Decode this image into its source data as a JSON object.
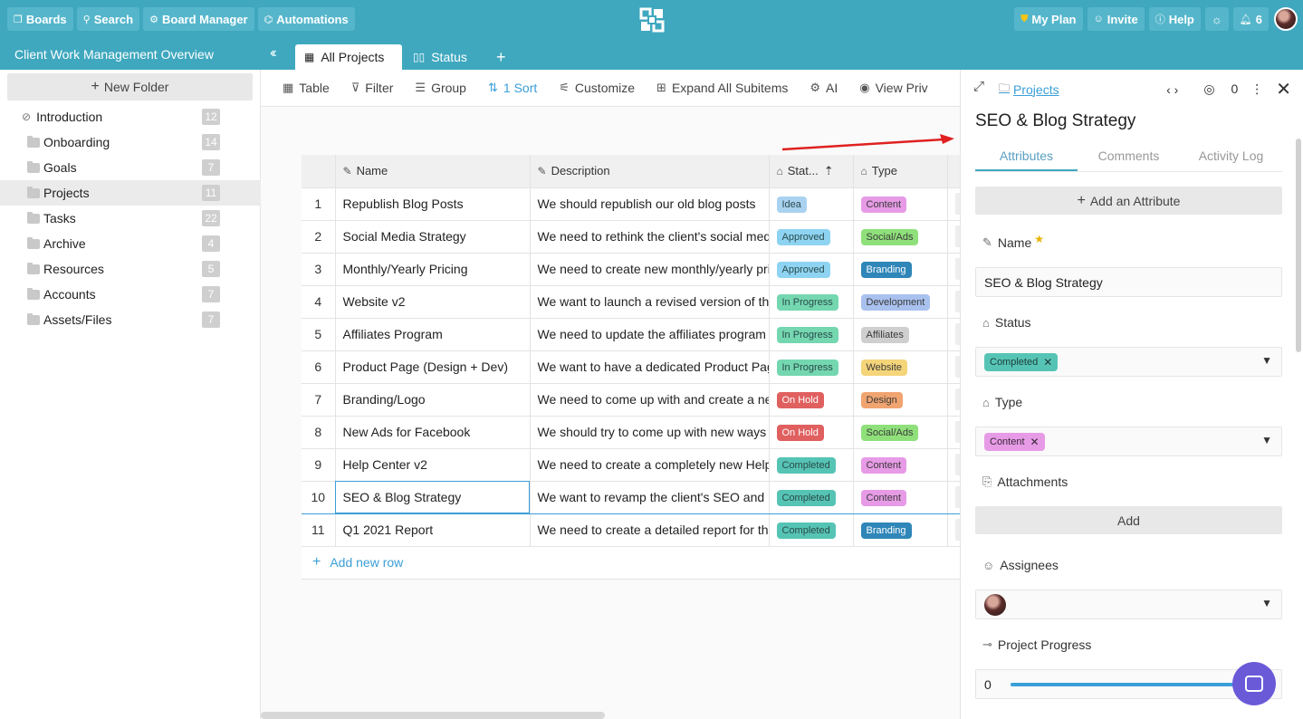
{
  "topbar": {
    "boards": "Boards",
    "search": "Search",
    "board_manager": "Board Manager",
    "automations": "Automations",
    "my_plan": "My Plan",
    "invite": "Invite",
    "help": "Help",
    "notifications": "6"
  },
  "board": {
    "title": "Client Work Management Overview",
    "tabs": [
      {
        "label": "All Projects"
      },
      {
        "label": "Status"
      }
    ]
  },
  "sidebar": {
    "new_folder": "New Folder",
    "folders": [
      {
        "label": "Introduction",
        "count": "12"
      },
      {
        "label": "Onboarding",
        "count": "14"
      },
      {
        "label": "Goals",
        "count": "7"
      },
      {
        "label": "Projects",
        "count": "11"
      },
      {
        "label": "Tasks",
        "count": "22"
      },
      {
        "label": "Archive",
        "count": "4"
      },
      {
        "label": "Resources",
        "count": "5"
      },
      {
        "label": "Accounts",
        "count": "7"
      },
      {
        "label": "Assets/Files",
        "count": "7"
      }
    ]
  },
  "toolbar": {
    "table": "Table",
    "filter": "Filter",
    "group": "Group",
    "sort": "1 Sort",
    "customize": "Customize",
    "expand": "Expand All Subitems",
    "ai": "AI",
    "view": "View Priv"
  },
  "grid": {
    "headers": {
      "name": "Name",
      "description": "Description",
      "status": "Stat...",
      "type": "Type"
    },
    "rows": [
      {
        "n": "1",
        "name": "Republish Blog Posts",
        "desc": "We should republish our old blog posts",
        "status": "Idea",
        "type": "Content"
      },
      {
        "n": "2",
        "name": "Social Media Strategy",
        "desc": "We need to rethink the client's social media",
        "status": "Approved",
        "type": "Social/Ads"
      },
      {
        "n": "3",
        "name": "Monthly/Yearly Pricing",
        "desc": "We need to create new monthly/yearly pricing",
        "status": "Approved",
        "type": "Branding"
      },
      {
        "n": "4",
        "name": "Website v2",
        "desc": "We want to launch a revised version of the",
        "status": "In Progress",
        "type": "Development"
      },
      {
        "n": "5",
        "name": "Affiliates Program",
        "desc": "We need to update the affiliates program",
        "status": "In Progress",
        "type": "Affiliates"
      },
      {
        "n": "6",
        "name": "Product Page (Design + Dev)",
        "desc": "We want to have a dedicated Product Page",
        "status": "In Progress",
        "type": "Website"
      },
      {
        "n": "7",
        "name": "Branding/Logo",
        "desc": "We need to come up with and create a new",
        "status": "On Hold",
        "type": "Design"
      },
      {
        "n": "8",
        "name": "New Ads for Facebook",
        "desc": "We should try to come up with new ways",
        "status": "On Hold",
        "type": "Social/Ads"
      },
      {
        "n": "9",
        "name": "Help Center v2",
        "desc": "We need to create a completely new Help",
        "status": "Completed",
        "type": "Content"
      },
      {
        "n": "10",
        "name": "SEO & Blog Strategy",
        "desc": "We want to revamp the client's SEO and",
        "status": "Completed",
        "type": "Content"
      },
      {
        "n": "11",
        "name": "Q1 2021 Report",
        "desc": "We need to create a detailed report for the",
        "status": "Completed",
        "type": "Branding"
      }
    ],
    "add_row": "Add new row"
  },
  "colors": {
    "Idea": "#a9d2f0",
    "Approved": "#8ed4f2",
    "In Progress": "#74d7b0",
    "On Hold": "#e06060",
    "Completed": "#56c4b4",
    "Content": "#e79be6",
    "Social/Ads": "#8fe07a",
    "Branding": "#2f86b8",
    "Development": "#a9c1ee",
    "Affiliates": "#cfcfcf",
    "Website": "#f5d57a",
    "Design": "#f0a470"
  },
  "panel": {
    "breadcrumb": "Projects",
    "watchers": "0",
    "title": "SEO & Blog Strategy",
    "tabs": [
      "Attributes",
      "Comments",
      "Activity Log"
    ],
    "add_attribute": "Add an Attribute",
    "name_label": "Name",
    "name_value": "SEO & Blog Strategy",
    "status_label": "Status",
    "status_value": "Completed",
    "type_label": "Type",
    "type_value": "Content",
    "attachments_label": "Attachments",
    "add": "Add",
    "assignees_label": "Assignees",
    "progress_label": "Project Progress",
    "progress_value": "0"
  }
}
